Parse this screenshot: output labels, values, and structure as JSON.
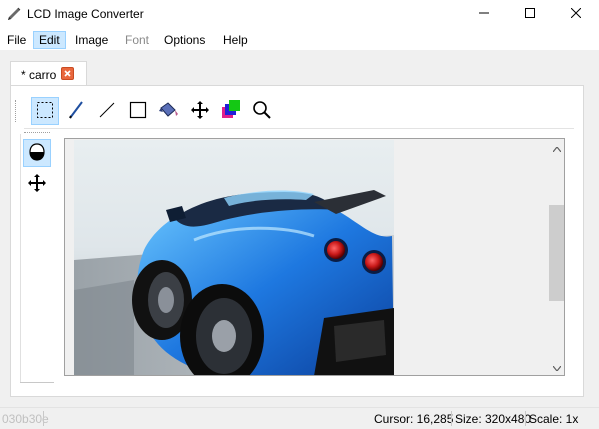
{
  "window": {
    "title": "LCD Image Converter",
    "icon": "pencil-icon",
    "controls": [
      "minimize-icon",
      "maximize-icon",
      "close-icon"
    ]
  },
  "menu": {
    "items": [
      {
        "label": "File",
        "state": "normal"
      },
      {
        "label": "Edit",
        "state": "active"
      },
      {
        "label": "Image",
        "state": "normal"
      },
      {
        "label": "Font",
        "state": "disabled"
      },
      {
        "label": "Options",
        "state": "normal"
      },
      {
        "label": "Help",
        "state": "normal"
      }
    ]
  },
  "tabs": [
    {
      "label": "* carro",
      "close_icon": "close-icon",
      "active": true
    }
  ],
  "toolbar": {
    "tools": [
      {
        "name": "select-rectangle-icon",
        "selected": true
      },
      {
        "name": "pen-icon",
        "selected": false
      },
      {
        "name": "line-icon",
        "selected": false
      },
      {
        "name": "rectangle-icon",
        "selected": false
      },
      {
        "name": "fill-bucket-icon",
        "selected": false
      },
      {
        "name": "move-icon",
        "selected": false
      },
      {
        "name": "color-swap-icon",
        "selected": false
      },
      {
        "name": "zoom-icon",
        "selected": false
      }
    ]
  },
  "sidebar": {
    "tools": [
      {
        "name": "mouse-icon",
        "selected": true
      },
      {
        "name": "move-icon",
        "selected": false
      }
    ]
  },
  "canvas": {
    "image_alt": "car",
    "scrollbar": {
      "position": 0.34
    }
  },
  "statusbar": {
    "color": "030b30e",
    "cursor": "Cursor: 16,285",
    "size": "Size: 320x480",
    "scale": "Scale: 1x"
  },
  "colors": {
    "accent": "#cce8ff",
    "accent_border": "#99d1ff",
    "close_badge": "#e9673d"
  }
}
